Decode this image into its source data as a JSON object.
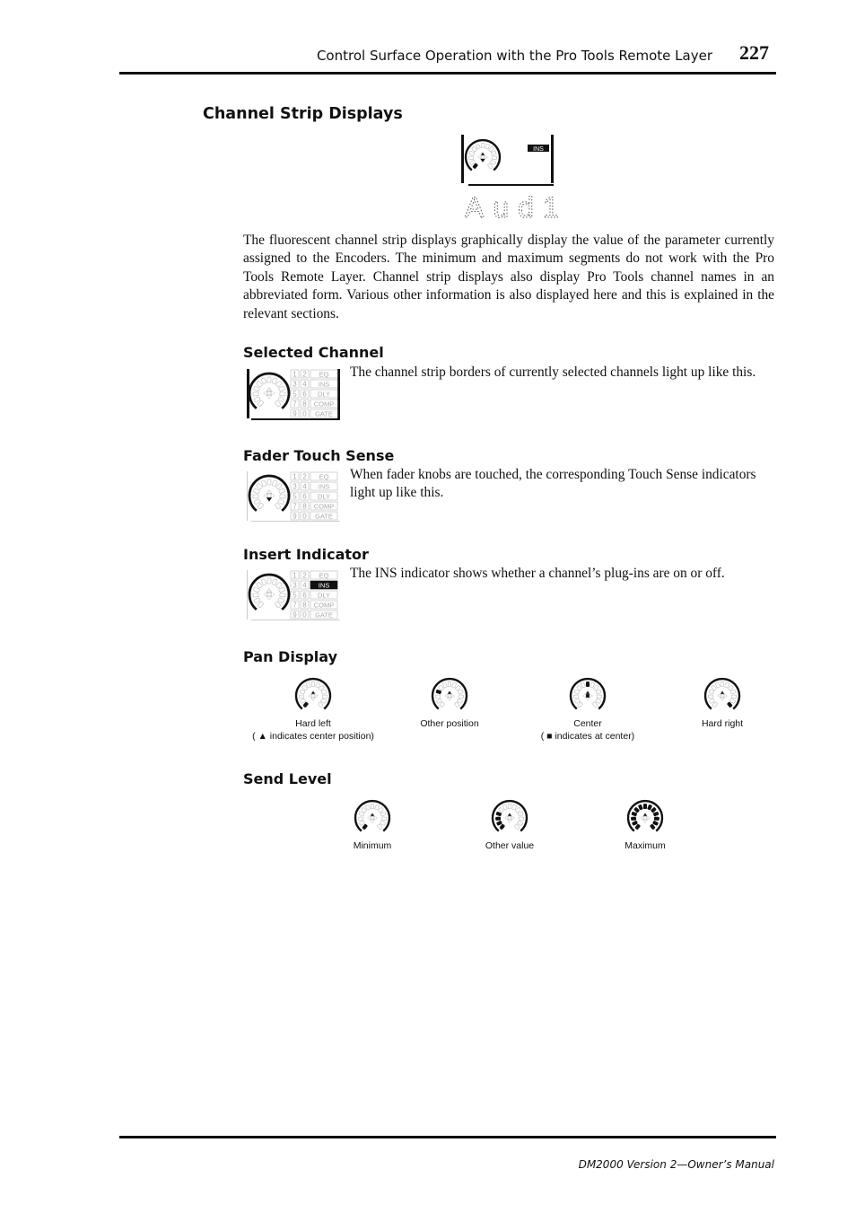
{
  "header": {
    "title": "Control Surface Operation with the Pro Tools Remote Layer",
    "page_number": "227"
  },
  "section": {
    "title": "Channel Strip Displays",
    "display_figure": {
      "indicator": "INS",
      "channel_name": "Aud1",
      "lit_segments": [
        0
      ],
      "down_arrow_lit": true
    },
    "intro": "The fluorescent channel strip displays graphically display the value of the parameter currently assigned to the Encoders. The minimum and maximum segments do not work with the Pro Tools Remote Layer. Channel strip displays also display Pro Tools channel names in an abbreviated form. Various other information is also displayed here and this is explained in the relevant sections."
  },
  "strip_labels": {
    "numbers": [
      "1",
      "2",
      "3",
      "4",
      "5",
      "6",
      "7",
      "8",
      "9",
      "0"
    ],
    "buttons": [
      "EQ",
      "INS",
      "DLY",
      "COMP",
      "GATE"
    ]
  },
  "subsections": [
    {
      "title": "Selected Channel",
      "text": "The channel strip borders of currently selected channels light up like this."
    },
    {
      "title": "Fader Touch Sense",
      "text": "When fader knobs are touched, the corresponding Touch Sense indicators light up like this."
    },
    {
      "title": "Insert Indicator",
      "text": "The INS indicator shows whether a channel’s plug-ins are on or off."
    }
  ],
  "pan_display": {
    "title": "Pan Display",
    "items": [
      {
        "caption": "Hard left",
        "note": "( ▲ indicates center position)",
        "lit_segments": [
          0
        ],
        "center_lit": false
      },
      {
        "caption": "Other position",
        "note": "",
        "lit_segments": [
          3
        ],
        "center_lit": false
      },
      {
        "caption": "Center",
        "note": "( ■ indicates at center)",
        "lit_segments": [
          6
        ],
        "center_lit": true
      },
      {
        "caption": "Hard right",
        "note": "",
        "lit_segments": [
          12
        ],
        "center_lit": false
      }
    ]
  },
  "send_level": {
    "title": "Send Level",
    "items": [
      {
        "caption": "Minimum",
        "lit_segments": [
          0
        ]
      },
      {
        "caption": "Other value",
        "lit_segments": [
          0,
          1,
          2,
          3
        ]
      },
      {
        "caption": "Maximum",
        "lit_segments": [
          0,
          1,
          2,
          3,
          4,
          5,
          6,
          7,
          8,
          9,
          10,
          11,
          12
        ]
      }
    ]
  },
  "footer": {
    "text": "DM2000 Version 2—Owner’s Manual"
  }
}
